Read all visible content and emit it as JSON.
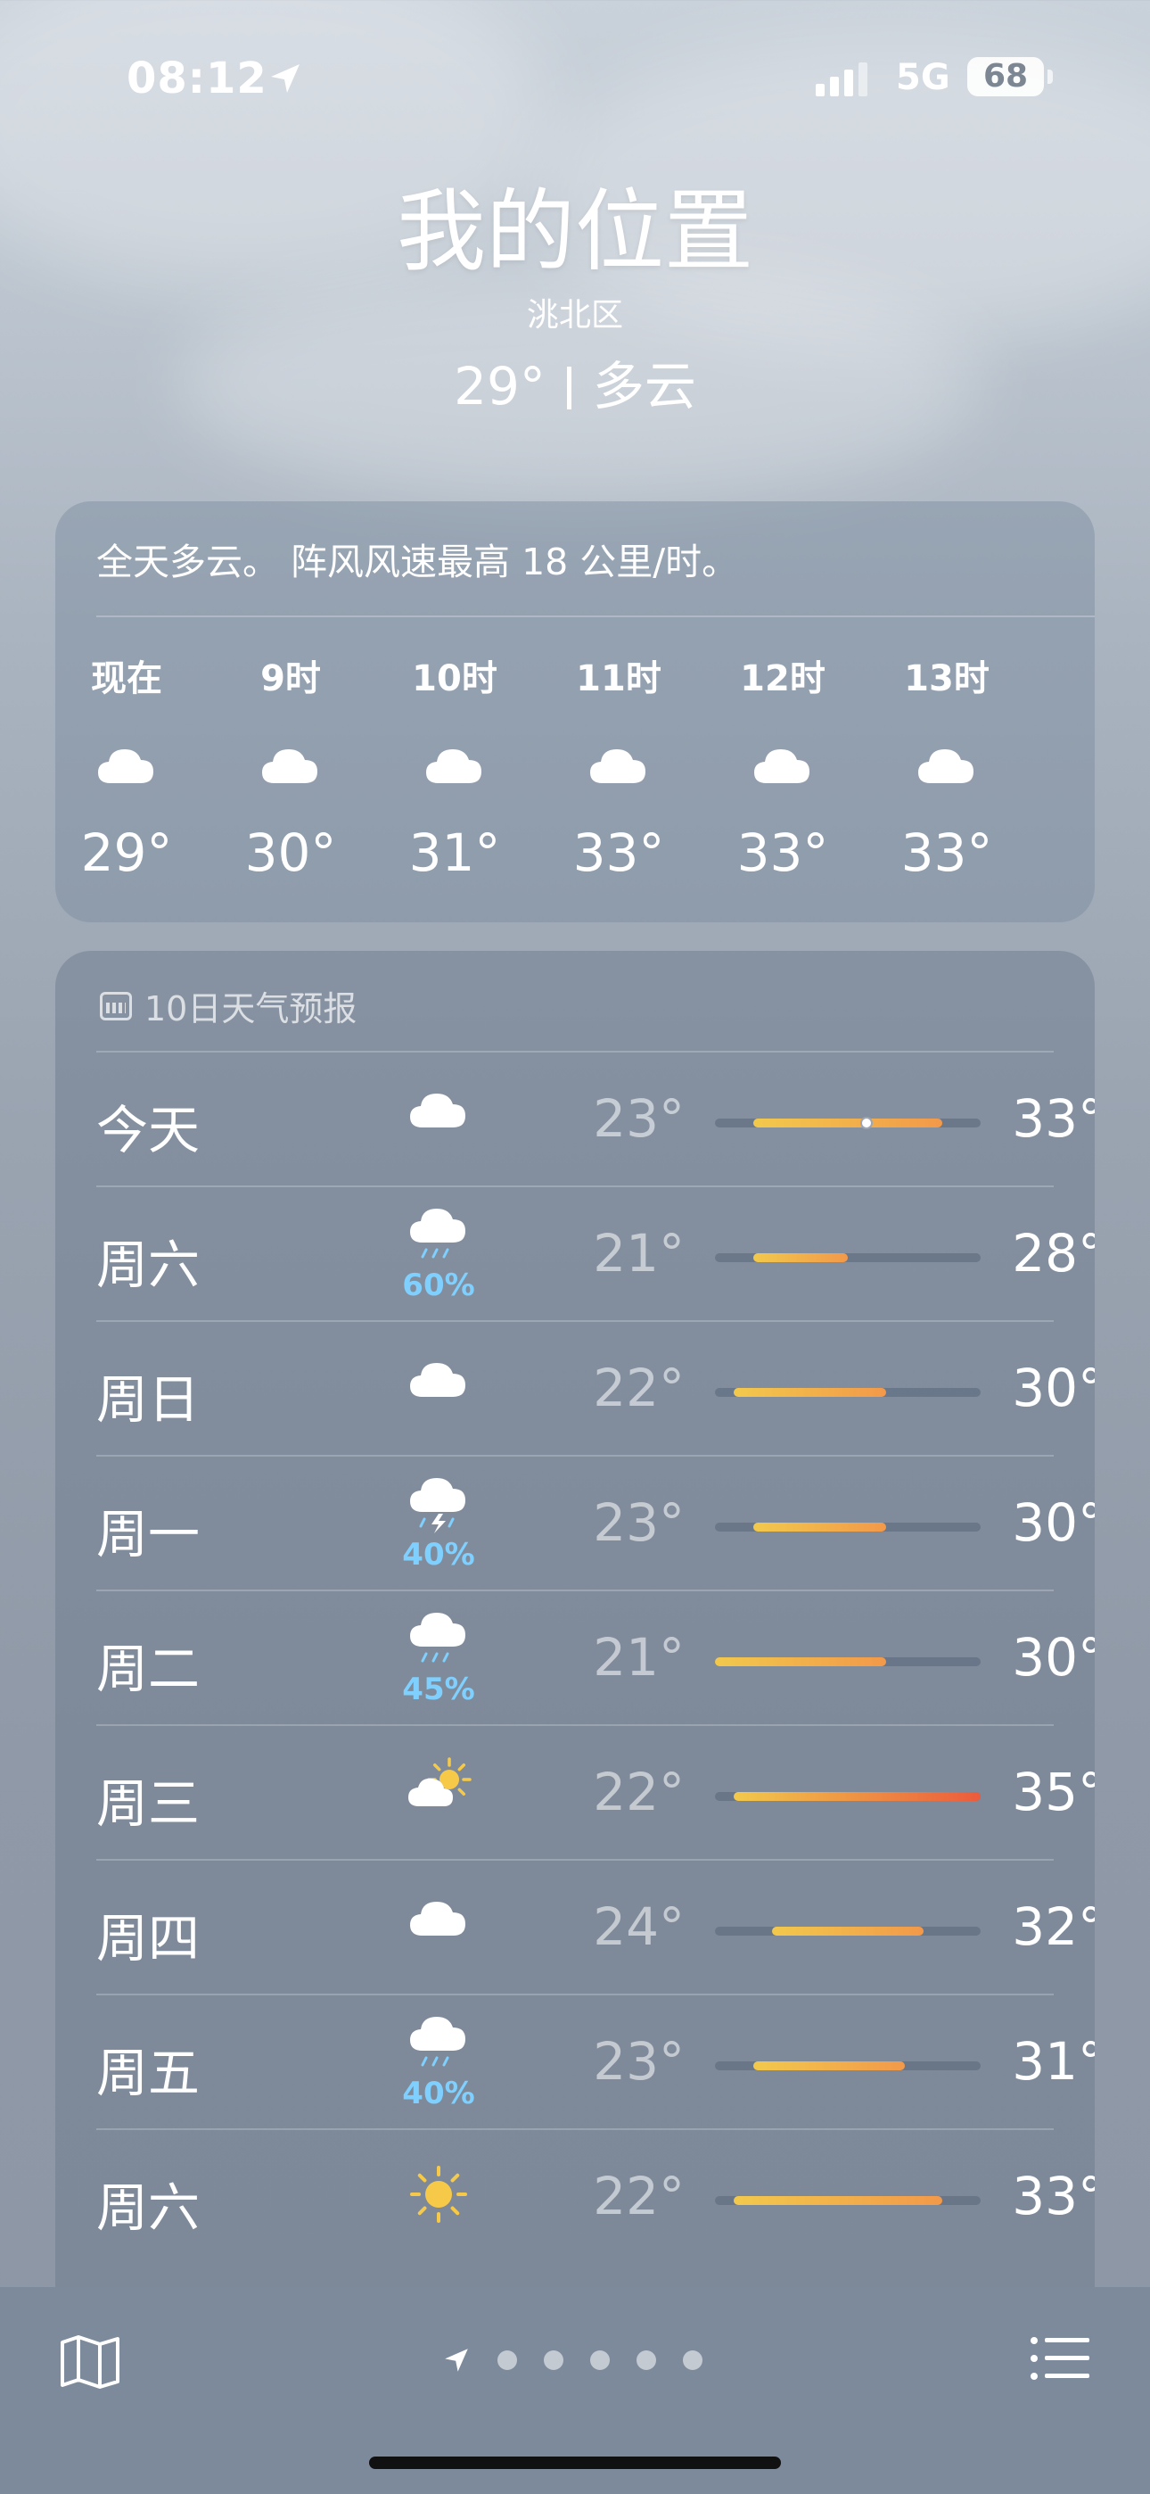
{
  "status_bar": {
    "time": "08:12",
    "network": "5G",
    "battery": "68"
  },
  "location": {
    "title": "我的位置",
    "district": "洮北区",
    "current_temp": "29°",
    "condition": "多云"
  },
  "hourly": {
    "summary": "全天多云。 阵风风速最高 18 公里/时。",
    "items": [
      {
        "label": "现在",
        "icon": "cloud-icon",
        "temp": "29°"
      },
      {
        "label": "9时",
        "icon": "cloud-icon",
        "temp": "30°"
      },
      {
        "label": "10时",
        "icon": "cloud-icon",
        "temp": "31°"
      },
      {
        "label": "11时",
        "icon": "cloud-icon",
        "temp": "33°"
      },
      {
        "label": "12时",
        "icon": "cloud-icon",
        "temp": "33°"
      },
      {
        "label": "13时",
        "icon": "cloud-icon",
        "temp": "33°"
      }
    ]
  },
  "forecast": {
    "title": "10日天气预报",
    "range_min": 21,
    "range_max": 35,
    "days": [
      {
        "day": "今天",
        "icon": "cloud-icon",
        "precip": "",
        "low": "23°",
        "high": "33°",
        "lowv": 23,
        "highv": 33,
        "current": 29
      },
      {
        "day": "周六",
        "icon": "cloud-rain-icon",
        "precip": "60%",
        "low": "21°",
        "high": "28°",
        "lowv": 23,
        "highv": 28
      },
      {
        "day": "周日",
        "icon": "cloud-icon",
        "precip": "",
        "low": "22°",
        "high": "30°",
        "lowv": 22,
        "highv": 30
      },
      {
        "day": "周一",
        "icon": "cloud-thunder-icon",
        "precip": "40%",
        "low": "23°",
        "high": "30°",
        "lowv": 23,
        "highv": 30
      },
      {
        "day": "周二",
        "icon": "cloud-rain-icon",
        "precip": "45%",
        "low": "21°",
        "high": "30°",
        "lowv": 21,
        "highv": 30
      },
      {
        "day": "周三",
        "icon": "sun-cloud-icon",
        "precip": "",
        "low": "22°",
        "high": "35°",
        "lowv": 22,
        "highv": 35
      },
      {
        "day": "周四",
        "icon": "cloud-icon",
        "precip": "",
        "low": "24°",
        "high": "32°",
        "lowv": 24,
        "highv": 32
      },
      {
        "day": "周五",
        "icon": "cloud-rain-icon",
        "precip": "40%",
        "low": "23°",
        "high": "31°",
        "lowv": 23,
        "highv": 31
      },
      {
        "day": "周六",
        "icon": "sun-icon",
        "precip": "",
        "low": "22°",
        "high": "33°",
        "lowv": 22,
        "highv": 33
      }
    ]
  },
  "colors": {
    "bar_cool": "#f2c94c",
    "bar_warm": "#f2994a",
    "bar_hot": "#eb5b3c",
    "precip": "#7fd0ff"
  },
  "bottom_bar": {
    "icons": [
      "map-icon",
      "location-arrow-icon",
      "list-icon"
    ],
    "page_dots": 5
  }
}
